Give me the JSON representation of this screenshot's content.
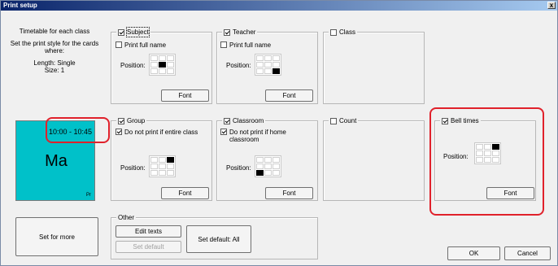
{
  "window": {
    "title": "Print setup",
    "close_label": "x"
  },
  "left_info": {
    "line1": "Timetable for each class",
    "line2": "Set the print style for the cards",
    "line3": "where:",
    "line4": "Length: Single",
    "line5": "Size: 1"
  },
  "preview": {
    "time": "10:00 - 10:45",
    "subject": "Ma",
    "corner": "Pr"
  },
  "subject": {
    "label": "Subject",
    "print_full_name": "Print full name",
    "position": "Position:",
    "font": "Font"
  },
  "teacher": {
    "label": "Teacher",
    "print_full_name": "Print full name",
    "position": "Position:",
    "font": "Font"
  },
  "class": {
    "label": "Class"
  },
  "group": {
    "label": "Group",
    "option": "Do not print if entire class",
    "position": "Position:",
    "font": "Font"
  },
  "classroom": {
    "label": "Classroom",
    "option_line1": "Do not print if home",
    "option_line2": "classroom",
    "position": "Position:",
    "font": "Font"
  },
  "count": {
    "label": "Count"
  },
  "bell": {
    "label": "Bell times",
    "position": "Position:",
    "font": "Font"
  },
  "other": {
    "label": "Other",
    "edit_texts": "Edit texts",
    "set_default": "Set default",
    "set_default_all": "Set default: All"
  },
  "buttons": {
    "set_for_more": "Set for more",
    "ok": "OK",
    "cancel": "Cancel"
  },
  "colors": {
    "preview_bg": "#00c1c9",
    "highlight": "#e0212b"
  }
}
